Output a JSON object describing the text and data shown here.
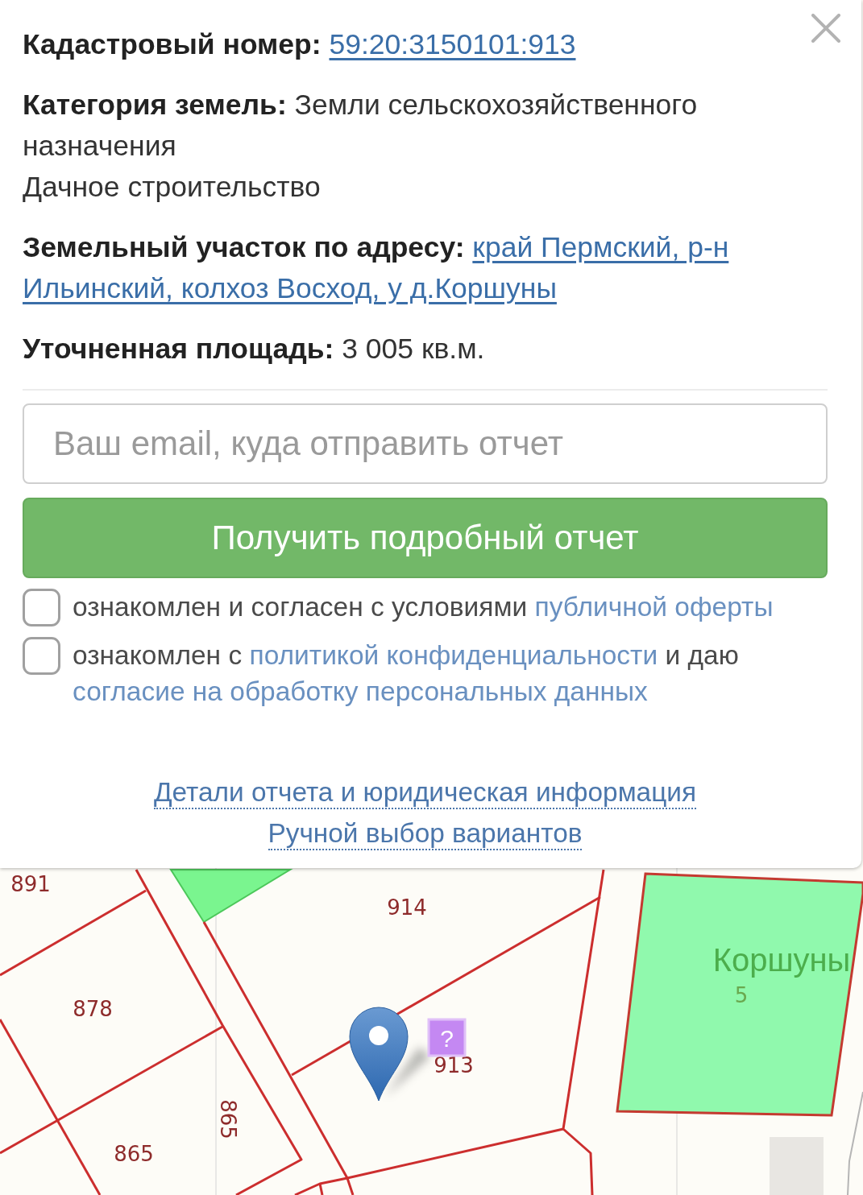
{
  "popup": {
    "fields": [
      {
        "kind": "link",
        "label": "Кадастровый номер:",
        "value": [
          "59:20:3150101:913"
        ]
      },
      {
        "kind": "text",
        "text": "**Категория земель:** Земли сельскохозяйственного назначения",
        "extra": "Дачное строительство"
      },
      {
        "kind": "link",
        "label": "Земельный участок по адресу:",
        "value": [
          "край Пермский, р-н",
          "Ильинский, колхоз Восход, у д.Коршуны"
        ]
      },
      {
        "kind": "text",
        "text": "**Уточненная площадь:** 3 005 кв.м."
      }
    ],
    "email_field": {
      "placeholder": "Ваш email, куда отправить отчет"
    },
    "submit_button": "Получить подробный отчет",
    "consents": [
      {
        "checked": false,
        "parts": [
          {
            "kind": "text",
            "text": "ознакомлен и согласен с условиями"
          },
          {
            "kind": "link",
            "text": "публичной оферты"
          }
        ]
      },
      {
        "checked": false,
        "parts": [
          {
            "kind": "text",
            "text": "ознакомлен с"
          },
          {
            "kind": "link",
            "text": "политикой конфиденциальности"
          },
          {
            "kind": "text",
            "text": "и даю"
          },
          {
            "kind": "link",
            "text": "согласие на обработку персональных данных"
          }
        ]
      }
    ],
    "footer_links": [
      "Детали отчета и юридическая информация",
      "Ручной выбор вариантов"
    ]
  },
  "map": {
    "labels": [
      {
        "kind": "parcel",
        "text": "891"
      },
      {
        "kind": "parcel",
        "text": "914"
      },
      {
        "kind": "settlement",
        "text": "Коршуны"
      },
      {
        "kind": "house",
        "text": "5"
      },
      {
        "kind": "parcel",
        "text": "878"
      },
      {
        "kind": "parcel",
        "text": "913"
      },
      {
        "kind": "parcel",
        "text": "865"
      },
      {
        "kind": "parcel",
        "text": "865"
      }
    ],
    "marker": "?"
  }
}
